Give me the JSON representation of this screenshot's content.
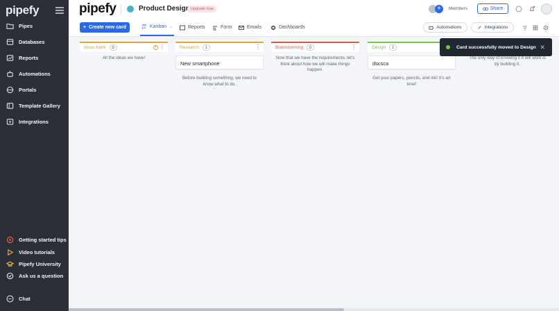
{
  "sidebar": {
    "logo": "pipefy",
    "items": [
      {
        "label": "Pipes",
        "icon": "folder-icon"
      },
      {
        "label": "Databases",
        "icon": "database-icon"
      },
      {
        "label": "Reports",
        "icon": "chart-icon"
      },
      {
        "label": "Automations",
        "icon": "robot-icon"
      },
      {
        "label": "Portals",
        "icon": "globe-icon"
      },
      {
        "label": "Template Gallery",
        "icon": "gallery-icon"
      },
      {
        "label": "Integrations",
        "icon": "plug-icon"
      }
    ],
    "bottom_items": [
      {
        "label": "Getting started tips",
        "icon": "target-icon",
        "color": "#e85d4a"
      },
      {
        "label": "Video tutorials",
        "icon": "play-icon",
        "color": "#e8a33b"
      },
      {
        "label": "Pipefy University",
        "icon": "graduation-icon",
        "color": "#f0c040"
      },
      {
        "label": "Ask us a question",
        "icon": "question-icon",
        "color": "#e9ecf1"
      }
    ],
    "chat_label": "Chat"
  },
  "header": {
    "brand": "pipefy",
    "pipe_name": "Product Design",
    "pipe_color": "#3fb3c9",
    "upgrade_label": "Upgrade now",
    "members_label": "Members",
    "share_label": "Share"
  },
  "toolbar": {
    "create_label": "Create new card",
    "tabs": [
      {
        "label": "Kanban",
        "active": true
      },
      {
        "label": "Reports"
      },
      {
        "label": "Form"
      },
      {
        "label": "Emails"
      },
      {
        "label": "Dashboards"
      }
    ],
    "automations_label": "Automations",
    "integrations_label": "Integrations"
  },
  "board": {
    "columns": [
      {
        "title": "Ideas bank",
        "count": "0",
        "color": "#e3a23b",
        "empty_text": "All the ideas we have!",
        "cards": []
      },
      {
        "title": "Research",
        "count": "1",
        "color": "#e3a23b",
        "empty_text": "Before building something, we need to know what to do.",
        "cards": [
          "New smartphone"
        ]
      },
      {
        "title": "Brainstorming",
        "count": "0",
        "color": "#e05a3c",
        "empty_text": "Now that we have the requirements, let's think about how we will make things happen.",
        "cards": []
      },
      {
        "title": "Design",
        "count": "1",
        "color": "#74c83f",
        "empty_text": "Get your papers, pencils, and ink! It's art time!",
        "cards": [
          "dscsca"
        ]
      },
      {
        "title": "",
        "count": "",
        "color": "#74c83f",
        "empty_text": "The only way of knowing if it will work is by building it.",
        "cards": []
      }
    ]
  },
  "toast": {
    "message": "Card successfully moved to Design",
    "close": "✕"
  }
}
